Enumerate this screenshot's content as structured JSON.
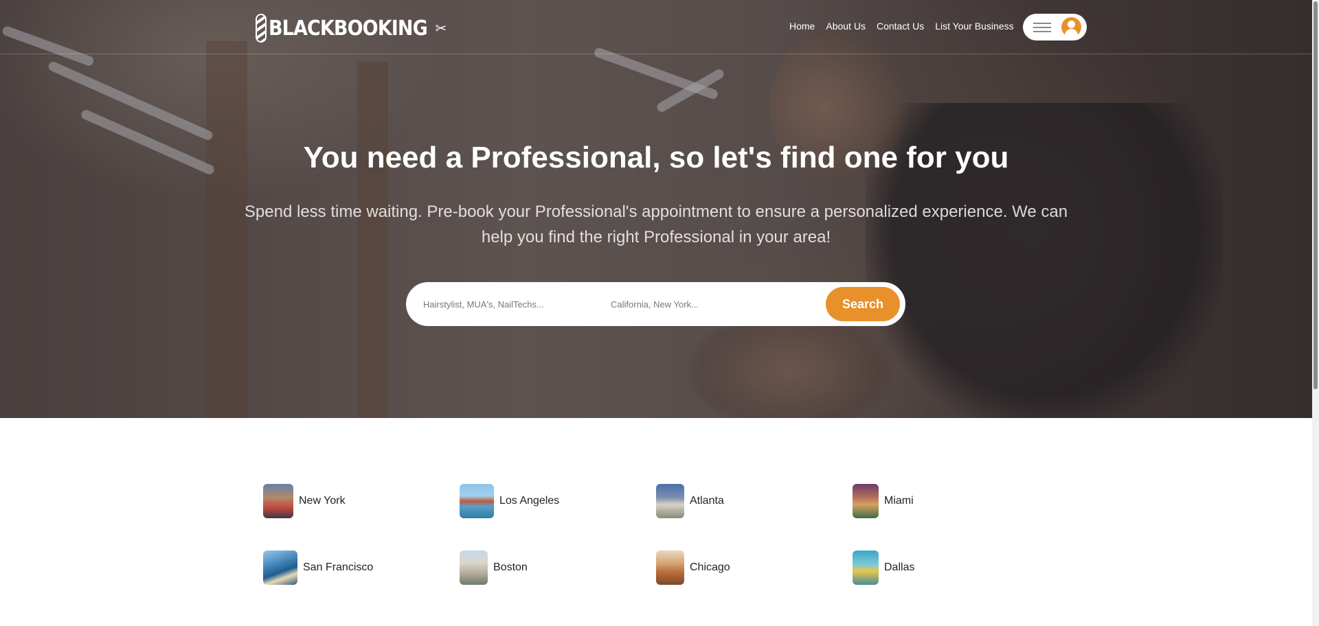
{
  "brand": {
    "logo_text": "BLACKBOOKING"
  },
  "nav": {
    "links": [
      "Home",
      "About Us",
      "Contact Us",
      "List Your Business"
    ]
  },
  "hero": {
    "title": "You need a Professional, so let's find one for you",
    "subtitle": "Spend less time waiting. Pre-book your Professional's appointment to ensure a personalized experience. We can help you find the right Professional in your area!"
  },
  "search": {
    "service_placeholder": "Hairstylist, MUA's, NailTechs...",
    "location_placeholder": "California, New York...",
    "button_label": "Search"
  },
  "cities": [
    {
      "name": "New York",
      "icon": "new-york-thumbnail"
    },
    {
      "name": "Los Angeles",
      "icon": "los-angeles-thumbnail"
    },
    {
      "name": "Atlanta",
      "icon": "atlanta-thumbnail"
    },
    {
      "name": "Miami",
      "icon": "miami-thumbnail"
    },
    {
      "name": "San Francisco",
      "icon": "san-francisco-thumbnail"
    },
    {
      "name": "Boston",
      "icon": "boston-thumbnail"
    },
    {
      "name": "Chicago",
      "icon": "chicago-thumbnail"
    },
    {
      "name": "Dallas",
      "icon": "dallas-thumbnail"
    }
  ],
  "colors": {
    "accent": "#e8912b",
    "hero_overlay": "#3a3236",
    "text_dark": "#222222"
  }
}
